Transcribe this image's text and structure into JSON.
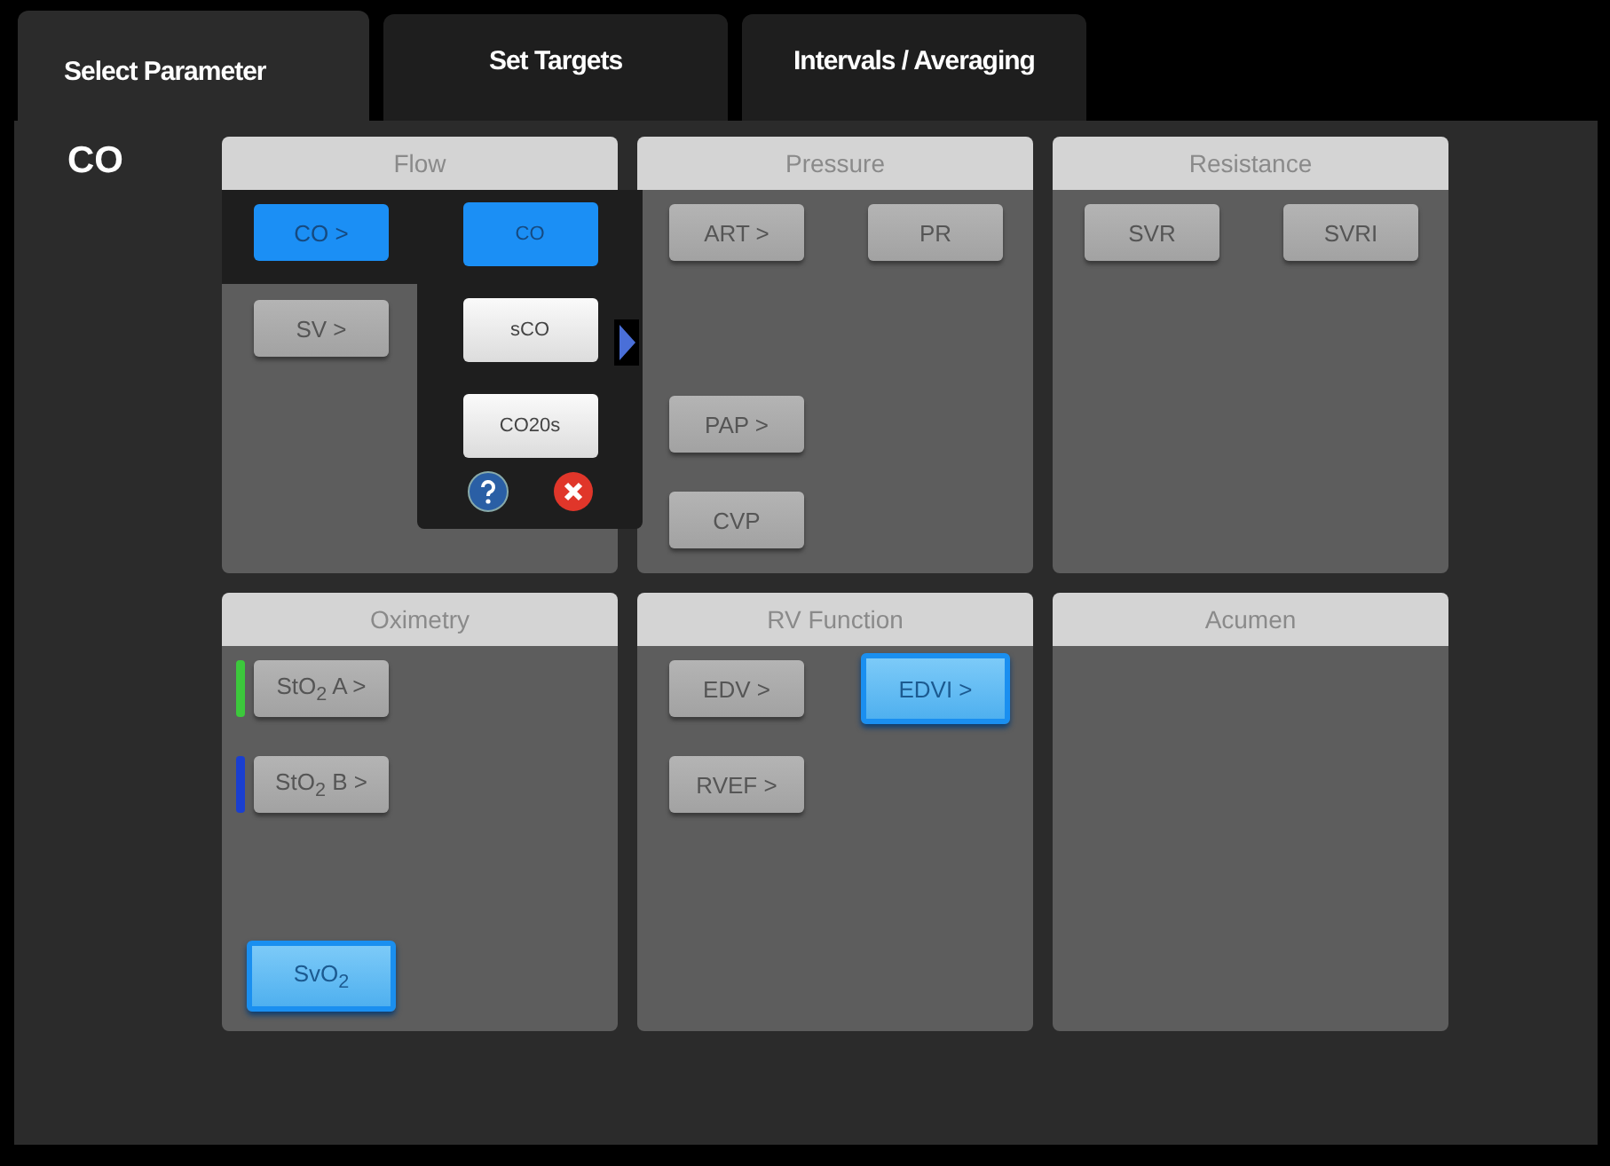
{
  "tabs": [
    {
      "label": "Select Parameter",
      "selected": true
    },
    {
      "label": "Set Targets",
      "selected": false
    },
    {
      "label": "Intervals / Averaging",
      "selected": false
    }
  ],
  "current_parameter": "CO",
  "panels": [
    {
      "title": "Flow",
      "buttons": [
        {
          "label": "CO >",
          "selected": true
        },
        {
          "label": "SV >",
          "selected": false
        }
      ],
      "popup": {
        "options": [
          {
            "label": "CO",
            "selected": true
          },
          {
            "label": "sCO",
            "selected": false
          },
          {
            "label": "CO20s",
            "selected": false
          }
        ]
      }
    },
    {
      "title": "Pressure",
      "buttons": [
        {
          "label": "ART >",
          "selected": false
        },
        {
          "label": "PR",
          "selected": false
        },
        {
          "label": "PAP >",
          "selected": false
        },
        {
          "label": "CVP",
          "selected": false
        }
      ]
    },
    {
      "title": "Resistance",
      "buttons": [
        {
          "label": "SVR",
          "selected": false
        },
        {
          "label": "SVRI",
          "selected": false
        }
      ]
    },
    {
      "title": "Oximetry",
      "buttons": [
        {
          "label": "StO$_{2}$ A >",
          "selected": false,
          "color": "#3cc83c"
        },
        {
          "label": "StO$_{2}$ B >",
          "selected": false,
          "color": "#1a3fd0"
        },
        {
          "label": "SvO$_{2}$",
          "selected": true
        }
      ]
    },
    {
      "title": "RV Function",
      "buttons": [
        {
          "label": "EDV >",
          "selected": false
        },
        {
          "label": "EDVI >",
          "selected": true
        },
        {
          "label": "RVEF >",
          "selected": false
        }
      ]
    },
    {
      "title": "Acumen"
    }
  ]
}
